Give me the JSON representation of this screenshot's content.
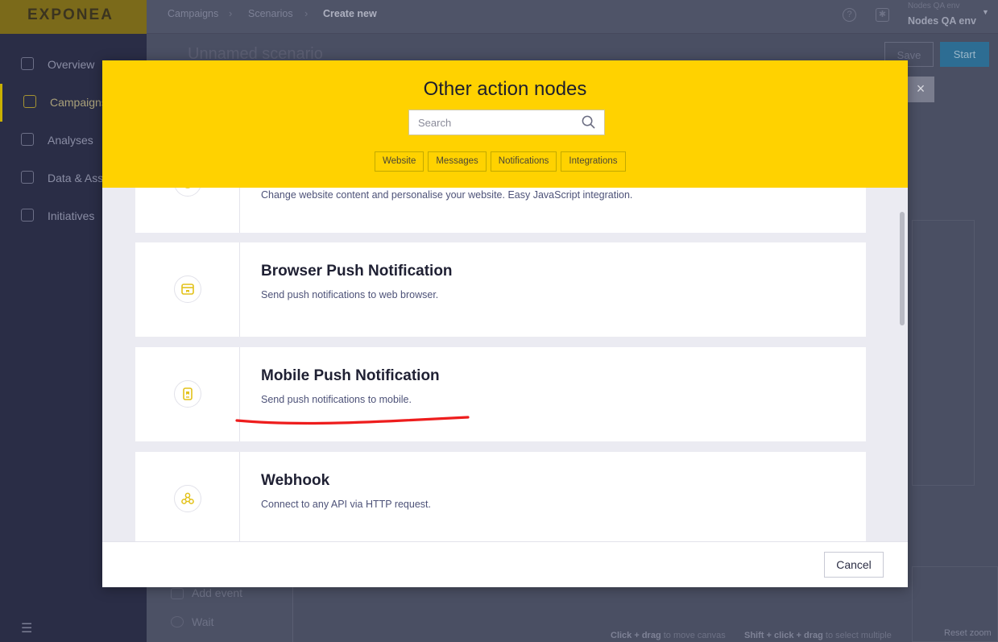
{
  "app": {
    "logo": "EXPONEA",
    "nav": [
      {
        "label": "Overview",
        "icon": "gauge-icon"
      },
      {
        "label": "Campaigns",
        "icon": "megaphone-icon",
        "active": true
      },
      {
        "label": "Analyses",
        "icon": "chart-icon"
      },
      {
        "label": "Data & Assets",
        "icon": "database-icon"
      },
      {
        "label": "Initiatives",
        "icon": "folder-icon"
      }
    ],
    "breadcrumb": [
      "Campaigns",
      "Scenarios",
      "Create new"
    ],
    "env": {
      "label": "Nodes QA env",
      "name": "Nodes QA env"
    },
    "scenario_title": "Unnamed scenario",
    "save_label": "Save",
    "start_label": "Start",
    "bottom_items": [
      "Add event",
      "Wait"
    ],
    "hints": {
      "drag_key": "Click + drag",
      "drag_text": "to move canvas",
      "select_key": "Shift + click + drag",
      "select_text": "to select multiple"
    },
    "reset_zoom": "Reset zoom"
  },
  "modal": {
    "title": "Other action nodes",
    "search_placeholder": "Search",
    "filters": [
      "Website",
      "Messages",
      "Notifications",
      "Integrations"
    ],
    "items": [
      {
        "title": "",
        "desc": "Change website content and personalise your website. Easy JavaScript integration.",
        "icon": "website-icon"
      },
      {
        "title": "Browser Push Notification",
        "desc": "Send push notifications to web browser.",
        "icon": "browser-push-icon"
      },
      {
        "title": "Mobile Push Notification",
        "desc": "Send push notifications to mobile.",
        "icon": "mobile-push-icon"
      },
      {
        "title": "Webhook",
        "desc": "Connect to any API via HTTP request.",
        "icon": "webhook-icon"
      }
    ],
    "cancel_label": "Cancel"
  },
  "colors": {
    "header_yellow": "#ffd200",
    "annotation_red": "#ee1d1d",
    "sidebar_bg": "#2a2d46"
  }
}
